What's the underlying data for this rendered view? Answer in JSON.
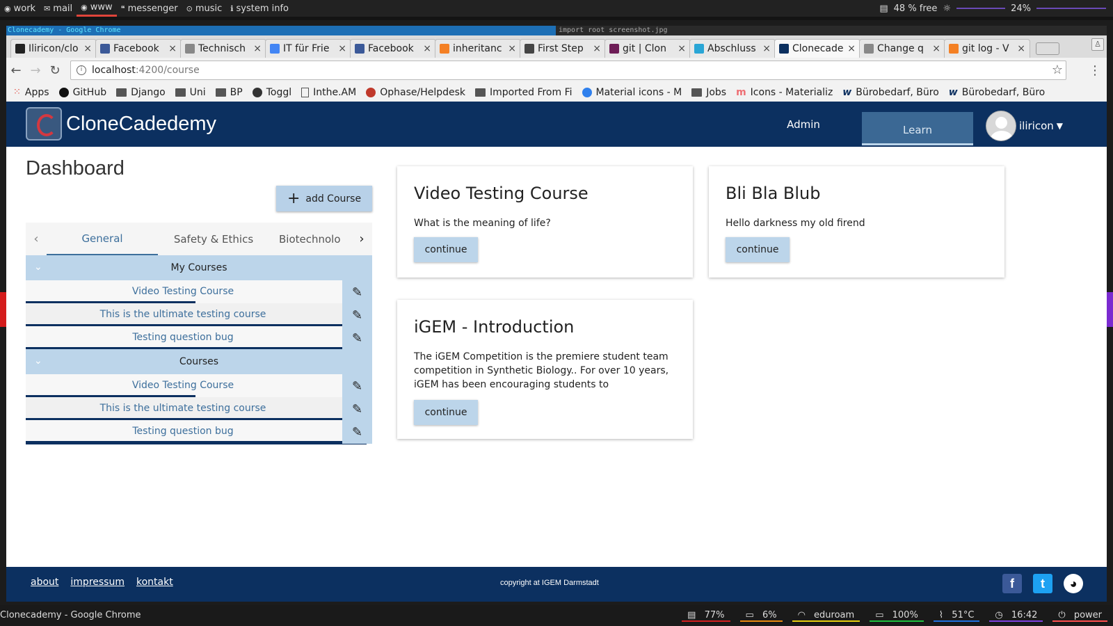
{
  "wm": {
    "workspaces": [
      {
        "label": "work",
        "icon": "globe-icon"
      },
      {
        "label": "mail",
        "icon": "envelope-icon"
      },
      {
        "label": "www",
        "icon": "globe-icon",
        "active": true
      },
      {
        "label": "messenger",
        "icon": "quote-icon"
      },
      {
        "label": "music",
        "icon": "play-icon"
      },
      {
        "label": "system info",
        "icon": "info-icon"
      }
    ],
    "disk": "48 % free",
    "volume": "24%"
  },
  "window": {
    "title": "Clonecademy - Google Chrome",
    "other_title": "import root screenshot.jpg"
  },
  "browser": {
    "tabs": [
      {
        "label": "Iliricon/clo",
        "fav_color": "#222"
      },
      {
        "label": "Facebook",
        "fav_color": "#3b5998"
      },
      {
        "label": "Technisch",
        "fav_color": "#888"
      },
      {
        "label": "IT für Frie",
        "fav_color": "#4285f4"
      },
      {
        "label": "Facebook",
        "fav_color": "#3b5998"
      },
      {
        "label": "inheritanc",
        "fav_color": "#f48024"
      },
      {
        "label": "First Step",
        "fav_color": "#444"
      },
      {
        "label": "git | Clon",
        "fav_color": "#6e1d57"
      },
      {
        "label": "Abschluss",
        "fav_color": "#2aa6d6"
      },
      {
        "label": "Clonecade",
        "fav_color": "#0c3060",
        "active": true
      },
      {
        "label": "Change q",
        "fav_color": "#888"
      },
      {
        "label": "git log - V",
        "fav_color": "#f48024"
      }
    ],
    "url_host": "localhost",
    "url_path": ":4200/course",
    "bookmarks": [
      {
        "label": "Apps",
        "icon": "apps-grid-icon"
      },
      {
        "label": "GitHub",
        "icon": "github-icon"
      },
      {
        "label": "Django",
        "icon": "folder-icon"
      },
      {
        "label": "Uni",
        "icon": "folder-icon"
      },
      {
        "label": "BP",
        "icon": "folder-icon"
      },
      {
        "label": "Toggl",
        "icon": "toggl-icon"
      },
      {
        "label": "Inthe.AM",
        "icon": "page-icon"
      },
      {
        "label": "Ophase/Helpdesk",
        "icon": "bug-icon"
      },
      {
        "label": "Imported From Fi",
        "icon": "folder-icon"
      },
      {
        "label": "Material icons - M",
        "icon": "circle-icon"
      },
      {
        "label": "Jobs",
        "icon": "folder-icon"
      },
      {
        "label": "Icons - Materializ",
        "icon": "materialize-icon"
      },
      {
        "label": "Bürobedarf, Büro",
        "icon": "w-icon"
      },
      {
        "label": "Bürobedarf, Büro",
        "icon": "w-icon"
      }
    ]
  },
  "app": {
    "brand": "CloneCadedemy",
    "nav_admin": "Admin",
    "nav_learn": "Learn",
    "user": "iliricon",
    "dashboard_title": "Dashboard",
    "add_course": "add Course",
    "categories": [
      "General",
      "Safety & Ethics",
      "Biotechnolo"
    ],
    "groups": [
      {
        "title": "My Courses",
        "courses": [
          {
            "name": "Video Testing Course",
            "progress": 0.54
          },
          {
            "name": "This is the ultimate testing course",
            "progress": 1.0
          },
          {
            "name": "Testing question bug",
            "progress": 1.0
          }
        ]
      },
      {
        "title": "Courses",
        "courses": [
          {
            "name": "Video Testing Course",
            "progress": 0.54
          },
          {
            "name": "This is the ultimate testing course",
            "progress": 1.0
          },
          {
            "name": "Testing question bug",
            "progress": 1.0
          }
        ]
      }
    ],
    "cards": [
      {
        "title": "Video Testing Course",
        "desc": "What is the meaning of life?",
        "button": "continue"
      },
      {
        "title": "Bli Bla Blub",
        "desc": "Hello darkness my old firend",
        "button": "continue"
      },
      {
        "title": "iGEM - Introduction",
        "desc": "The iGEM Competition is the premiere student team competition in Synthetic Biology.. For over 10 years, iGEM has been encouraging students to",
        "button": "continue"
      }
    ]
  },
  "footer": {
    "links": [
      "about",
      "impressum",
      "kontakt"
    ],
    "copyright": "copyright at IGEM Darmstadt"
  },
  "statusbar": {
    "title": "Clonecademy - Google Chrome",
    "items": [
      {
        "label": "77%",
        "color": "#d42020"
      },
      {
        "label": "6%",
        "color": "#e88a10"
      },
      {
        "label": "eduroam",
        "color": "#e8d010"
      },
      {
        "label": "100%",
        "color": "#20c040"
      },
      {
        "label": "51°C",
        "color": "#2070e0"
      },
      {
        "label": "16:42",
        "color": "#8040e0"
      },
      {
        "label": "power",
        "color": "#ff5050"
      }
    ]
  }
}
